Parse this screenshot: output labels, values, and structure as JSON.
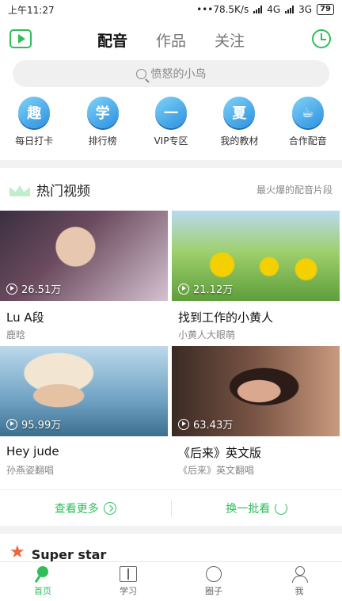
{
  "status_bar": {
    "time": "上午11:27",
    "network": "•••78.5K/s",
    "net_type_1": "4G",
    "net_type_2": "3G",
    "battery": "79"
  },
  "header": {
    "tabs": [
      {
        "label": "配音"
      },
      {
        "label": "作品"
      },
      {
        "label": "关注"
      }
    ]
  },
  "search": {
    "placeholder": "愤怒的小鸟"
  },
  "quick_menu": [
    {
      "badge": "趣",
      "label": "每日打卡"
    },
    {
      "badge": "学",
      "label": "排行榜"
    },
    {
      "badge": "一",
      "label": "VIP专区"
    },
    {
      "badge": "夏",
      "label": "我的教材"
    },
    {
      "badge": "",
      "label": "合作配音"
    }
  ],
  "hot_section": {
    "title": "热门视频",
    "more": "最火爆的配音片段"
  },
  "videos": [
    {
      "plays": "26.51万",
      "title": "Lu A段",
      "subtitle": "鹿晗"
    },
    {
      "plays": "21.12万",
      "title": "找到工作的小黄人",
      "subtitle": "小黄人大眼萌"
    },
    {
      "plays": "95.99万",
      "title": "Hey jude",
      "subtitle": "孙燕姿翻唱"
    },
    {
      "plays": "63.43万",
      "title": "《后来》英文版",
      "subtitle": "《后来》英文翻唱"
    }
  ],
  "actions": {
    "more": "查看更多",
    "refresh": "换一批看"
  },
  "superstar": {
    "title": "Super star"
  },
  "bottom_nav": [
    {
      "label": "首页"
    },
    {
      "label": "学习"
    },
    {
      "label": "圈子"
    },
    {
      "label": "我"
    }
  ],
  "colors": {
    "accent": "#2ebe5a",
    "badge_blue": "#2c8fe0"
  }
}
